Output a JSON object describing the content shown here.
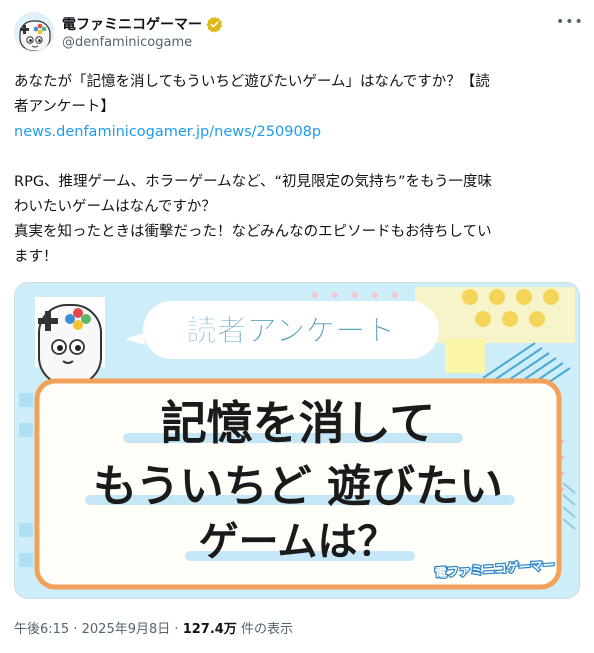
{
  "account": {
    "display_name": "電ファミニコゲーマー",
    "handle": "@denfaminicogame",
    "verified_color": "#e2b719"
  },
  "tweet": {
    "line1": "あなたが「記憶を消してもういちど遊びたいゲーム」はなんですか？【読",
    "line2": "者アンケート】",
    "link": "news.denfaminicogamer.jp/news/250908p",
    "line3": "RPG、推理ゲーム、ホラーゲームなど、“初見限定の気持ち”をもう一度味",
    "line4": "わいたいゲームはなんですか？",
    "line5": "真実を知ったときは衝撃だった！などみんなのエピソードもお待ちしてい",
    "line6": "ます！"
  },
  "card": {
    "badge": "読者アンケート",
    "headline1": "記憶を消して",
    "headline2": "もういちど 遊びたい",
    "headline3": "ゲームは？",
    "logo": "電ファミニコゲーマー"
  },
  "meta": {
    "time": "午後6:15",
    "separator": "·",
    "date": "2025年9月8日",
    "views": "127.4万",
    "views_suffix": "件の表示"
  },
  "colors": {
    "accent_blue": "#1d9bf0",
    "frame_orange": "#f2a15b",
    "card_bg": "#cdeef9",
    "badge_text": "#3f93b3"
  }
}
